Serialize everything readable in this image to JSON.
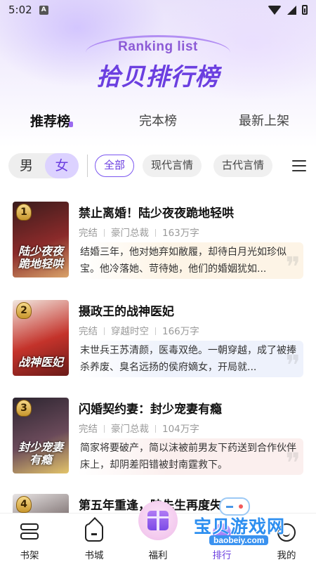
{
  "status_bar": {
    "time": "5:02",
    "notification_badge": "A"
  },
  "hero": {
    "title_en": "Ranking list",
    "title_cn": "拾贝排行榜"
  },
  "rank_tabs": [
    {
      "label": "推荐榜",
      "active": true
    },
    {
      "label": "完本榜",
      "active": false
    },
    {
      "label": "最新上架",
      "active": false
    }
  ],
  "gender_toggle": {
    "male": "男",
    "female": "女",
    "selected": "女"
  },
  "category_chips": [
    {
      "label": "全部",
      "active": true
    },
    {
      "label": "现代言情",
      "active": false
    },
    {
      "label": "古代言情",
      "active": false
    }
  ],
  "books": [
    {
      "rank": "1",
      "title": "禁止离婚！陆少夜夜跪地轻哄",
      "status": "完结",
      "category": "豪门总裁",
      "words": "163万字",
      "description": "结婚三年，他对她弃如敝履，却待白月光如珍似宝。他冷落她、苛待她，他们的婚姻犹如...",
      "cover_text": "陆少夜夜跪地轻哄",
      "cover_colors": [
        "#3a1c1c",
        "#8a2a2a",
        "#d9a36a"
      ],
      "desc_bg": "#fdf4e6"
    },
    {
      "rank": "2",
      "title": "摄政王的战神医妃",
      "status": "完结",
      "category": "穿越时空",
      "words": "166万字",
      "description": "末世兵王苏清颜，医毒双绝。一朝穿越，成了被捧杀养废、臭名远扬的侯府嫡女，开局就...",
      "cover_text": "战神医妃",
      "cover_colors": [
        "#f2e8e0",
        "#c4332b",
        "#6a1a18"
      ],
      "desc_bg": "#eef2fc"
    },
    {
      "rank": "3",
      "title": "闪婚契约妻：封少宠妻有瘾",
      "status": "完结",
      "category": "豪门总裁",
      "words": "104万字",
      "description": "简家将要破产，简以沫被前男友下药送到合作伙伴床上，却阴差阳错被封南霆救下。",
      "cover_text": "封少宠妻有瘾",
      "cover_colors": [
        "#2c2530",
        "#6a4a5a",
        "#e3c46a"
      ],
      "desc_bg": "#fbefee"
    },
    {
      "rank": "4",
      "title": "第五年重逢，陆先生再度失控",
      "status": "",
      "category": "",
      "words": "",
      "description": "",
      "cover_text": "",
      "cover_colors": [
        "#e8e4e4",
        "#6a5c5c",
        "#3a3030"
      ],
      "desc_bg": "#ffffff"
    }
  ],
  "bottom_nav": [
    {
      "label": "书架",
      "icon": "bookshelf-icon"
    },
    {
      "label": "书城",
      "icon": "bookstore-icon"
    },
    {
      "label": "福利",
      "icon": "gift-icon"
    },
    {
      "label": "排行",
      "icon": "ranking-icon"
    },
    {
      "label": "我的",
      "icon": "profile-icon"
    }
  ],
  "watermark": {
    "text_cn": "宝贝游戏网",
    "url": "baobeiy.com"
  },
  "colors": {
    "accent": "#6b3fe0",
    "accent_light": "#dcd2ff",
    "muted": "#999999"
  }
}
